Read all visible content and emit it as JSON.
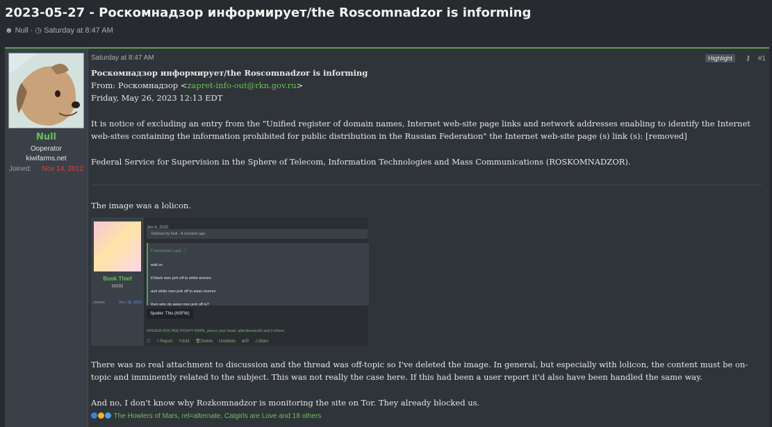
{
  "thread": {
    "title": "2023-05-27 - Роскомнадзор информирует/the Roscomnadzor is informing",
    "author": "Null",
    "date": "Saturday at 8:47 AM"
  },
  "user": {
    "name": "Null",
    "title": "Ooperator",
    "banner": "kiwifarms.net",
    "joined_label": "Joined:",
    "joined_date": "Nov 14, 2012"
  },
  "post": {
    "time": "Saturday at 8:47 AM",
    "highlight": "Highlight",
    "number": "#1",
    "heading": "Роскомнадзор информирует/the Roscomnadzor is informing",
    "from_prefix": "From: Роскомнадзор <",
    "from_email": "zapret-info-out@rkn.gov.ru",
    "from_suffix": ">",
    "date_line": "Friday, May 26, 2023 12:13 EDT",
    "notice": "It is notice of excluding an entry from the \"Unified register of domain names, Internet web-site page links and network addresses enabling to identify the Internet web-sites containing the information prohibited for public distribution in the Russian Federation\" the Internet web-site page (s) link (s): [removed]",
    "agency": "Federal Service for Supervision in the Sphere of Telecom, Information Technologies and Mass Communications (ROSKOMNADZOR).",
    "lolicon": "The image was a lolicon.",
    "explain": "There was no real attachment to discussion and the thread was off-topic so I've deleted the image. In general, but especially with lolicon, the content must be on-topic and imminently related to the subject. This was not really the case here. If this had been a user report it'd also have been handled the same way.",
    "tor": "And no, I don't know why Rozkomnadzor is monitoring the site on Tor. They already blocked us.",
    "reactions": "The Howlers of Mars, rel=alternate, Catgirls are Love and 18 others"
  },
  "embed": {
    "user_name": "Book Thief",
    "user_sub": "▯▯▯▯▯▯",
    "joined_label": "Joined:",
    "joined_date": "Dec 18, 2019",
    "date": "Jun 4, 2020",
    "deleted": "Deleted by Null · A moment ago",
    "quote_attr": "Franmaster said: ⓘ",
    "quote_lines": [
      "wait so",
      "if black men jerk off to white women",
      "and white men jerk off to asian women",
      "then who do asian men jerk off to?"
    ],
    "spoiler": "Spoiler: This (NSFW)",
    "reactions": "N!GGER ASS PEE POOPY RAPE, pierce your heart, albertbrown26 and 3 others",
    "actions": [
      "☐",
      "⚐Report",
      "✎Edit",
      "🗑Delete",
      "Undelete",
      "⊕IP",
      "⚠Warn"
    ]
  },
  "colors": {
    "accent": "#6cbf5d",
    "joined_red": "#e0443a",
    "bg": "#272b2f"
  }
}
